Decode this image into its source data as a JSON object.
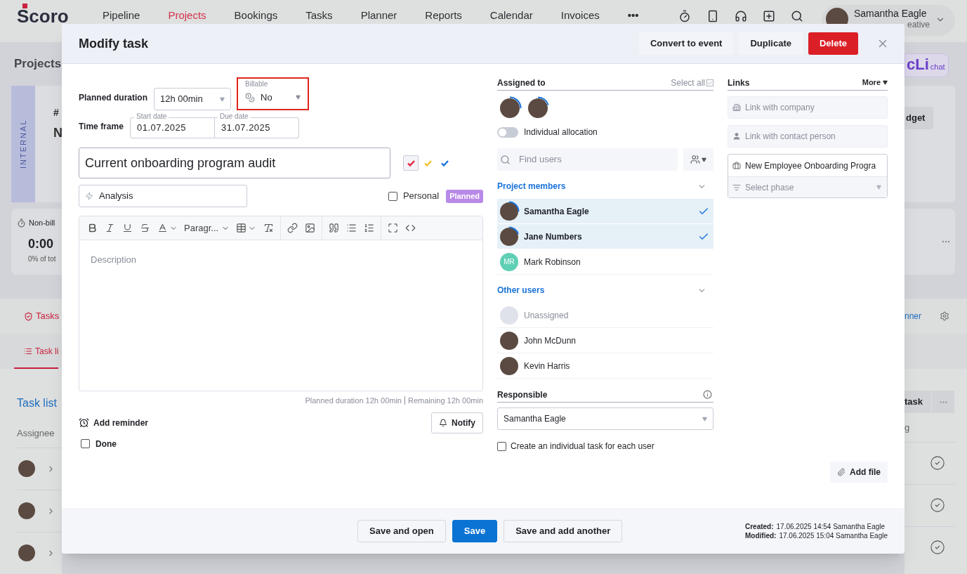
{
  "nav": {
    "logo": "Scoro",
    "items": [
      {
        "label": "Pipeline",
        "selected": false
      },
      {
        "label": "Projects",
        "selected": true
      },
      {
        "label": "Bookings",
        "selected": false
      },
      {
        "label": "Tasks",
        "selected": false
      },
      {
        "label": "Planner",
        "selected": false
      },
      {
        "label": "Reports",
        "selected": false
      },
      {
        "label": "Calendar",
        "selected": false
      },
      {
        "label": "Invoices",
        "selected": false
      }
    ],
    "more": "•••",
    "user": {
      "name": "Samantha Eagle",
      "role": "eative"
    }
  },
  "page": {
    "title": "Projects",
    "badge": "INTERNAL",
    "project_number": "#",
    "project_name": "N",
    "stat_label": "Non-bill",
    "stat_value": "0:00",
    "stat_sub": "0% of tot",
    "chat_logo": "cLi",
    "chat_label": "chat",
    "budget_button": "dget",
    "tabs": [
      {
        "label": "Tasks",
        "selected": true
      }
    ],
    "planner_link": "nner",
    "subtabs": [
      {
        "label": "Task li",
        "selected": true
      }
    ],
    "section_title": "Task list",
    "add_task": "task",
    "columns": [
      "Assignee",
      "g"
    ],
    "rows": [
      {
        "expanded": false
      },
      {
        "expanded": false
      },
      {
        "expanded": false
      }
    ]
  },
  "modal": {
    "title": "Modify task",
    "header_buttons": [
      {
        "label": "Convert to event",
        "kind": "secondary"
      },
      {
        "label": "Duplicate",
        "kind": "secondary"
      },
      {
        "label": "Delete",
        "kind": "danger"
      }
    ],
    "planned_duration": {
      "label": "Planned duration",
      "value": "12h 00min"
    },
    "billable": {
      "label": "Billable",
      "value": "No",
      "highlighted": true
    },
    "time_frame": {
      "label": "Time frame",
      "start_label": "Start date",
      "start": "01.07.2025",
      "due_label": "Due date",
      "due": "31.07.2025"
    },
    "task_name": "Current onboarding program audit",
    "priority_checks": [
      {
        "color": "#e5243b",
        "selected": true
      },
      {
        "color": "#f2c230",
        "selected": false
      },
      {
        "color": "#1a73d9",
        "selected": false
      }
    ],
    "activity": "Analysis",
    "personal": {
      "label": "Personal",
      "checked": false
    },
    "status_badge": "Planned",
    "toolbar": [
      [
        {
          "kind": "bold"
        },
        {
          "kind": "italic"
        },
        {
          "kind": "underline"
        },
        {
          "kind": "strike"
        },
        {
          "kind": "text-color",
          "caret": true
        },
        {
          "kind": "dropdown",
          "label": "Paragr...",
          "caret": true
        },
        {
          "kind": "table",
          "caret": true
        },
        {
          "kind": "clear-format"
        }
      ],
      [
        {
          "kind": "link"
        },
        {
          "kind": "image"
        }
      ],
      [
        {
          "kind": "quote"
        },
        {
          "kind": "bullet-list"
        },
        {
          "kind": "numbered-list"
        }
      ],
      [
        {
          "kind": "fullscreen"
        },
        {
          "kind": "code"
        }
      ]
    ],
    "description_placeholder": "Description",
    "duration_summary": [
      "Planned duration 12h 00min",
      "Remaining 12h 00min"
    ],
    "add_reminder": "Add reminder",
    "notify": "Notify",
    "done": {
      "label": "Done",
      "checked": false
    },
    "assigned": {
      "label": "Assigned to",
      "select_all": "Select all",
      "select_all_checked": true,
      "avatars": [
        {
          "level": 0.25
        },
        {
          "level": 0.2
        }
      ],
      "individual_allocation": {
        "label": "Individual allocation",
        "on": false
      },
      "find_placeholder": "Find users",
      "groups": [
        {
          "title": "Project members",
          "expanded": true,
          "users": [
            {
              "name": "Samantha Eagle",
              "kind": "photo",
              "selected": true,
              "level": 0.25
            },
            {
              "name": "Jane Numbers",
              "kind": "photo",
              "selected": true,
              "level": 0.2
            },
            {
              "name": "Mark Robinson",
              "kind": "initials",
              "initials": "MR",
              "color": "#5fcfb5",
              "selected": false
            }
          ]
        },
        {
          "title": "Other users",
          "expanded": true,
          "users": [
            {
              "name": "Unassigned",
              "kind": "none",
              "selected": false
            },
            {
              "name": "John McDunn",
              "kind": "photo",
              "selected": false
            },
            {
              "name": "Kevin Harris",
              "kind": "photo",
              "selected": false
            }
          ]
        }
      ]
    },
    "responsible": {
      "label": "Responsible",
      "value": "Samantha Eagle"
    },
    "individual_task": {
      "label": "Create an individual task for each user",
      "checked": false
    },
    "links": {
      "title": "Links",
      "more": "More",
      "company_placeholder": "Link with company",
      "contact_placeholder": "Link with contact person",
      "project": "New Employee Onboarding Progra",
      "phase_placeholder": "Select phase"
    },
    "add_file": "Add file",
    "footer_buttons": [
      {
        "label": "Save and open",
        "kind": "secondary"
      },
      {
        "label": "Save",
        "kind": "primary"
      },
      {
        "label": "Save and add another",
        "kind": "secondary"
      }
    ],
    "meta": [
      {
        "label": "Created:",
        "value": "17.06.2025 14:54 Samantha Eagle"
      },
      {
        "label": "Modified:",
        "value": "17.06.2025 15:04 Samantha Eagle"
      }
    ]
  }
}
